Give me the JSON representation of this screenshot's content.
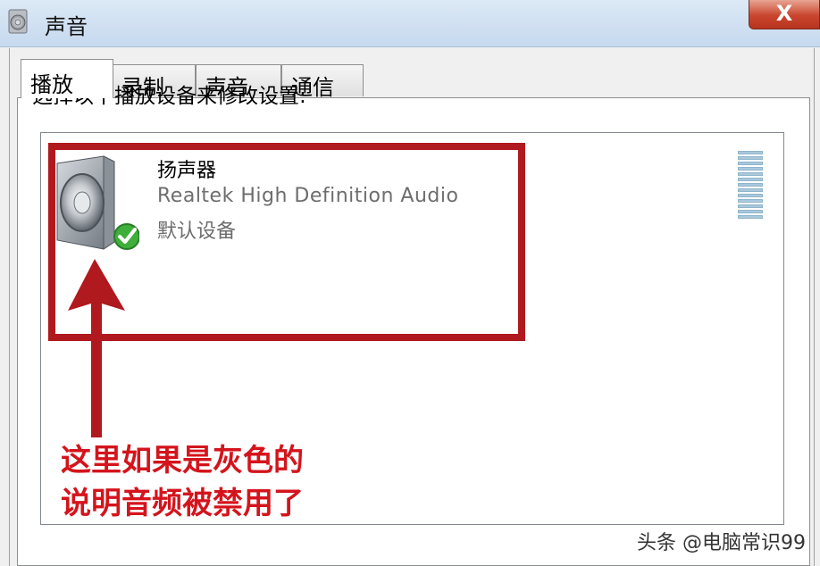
{
  "window": {
    "title": "声音",
    "close_label": "X"
  },
  "tabs": [
    {
      "label": "播放",
      "active": true
    },
    {
      "label": "录制",
      "active": false
    },
    {
      "label": "声音",
      "active": false
    },
    {
      "label": "通信",
      "active": false
    }
  ],
  "playback": {
    "instruction": "选择以下播放设备来修改设置:",
    "devices": [
      {
        "name": "扬声器",
        "driver": "Realtek High Definition Audio",
        "status": "默认设备",
        "icon": "speaker-icon",
        "default": true
      }
    ]
  },
  "annotation": {
    "line1": "这里如果是灰色的",
    "line2": "说明音频被禁用了",
    "color": "#d4141c"
  },
  "watermark": "头条 @电脑常识99"
}
